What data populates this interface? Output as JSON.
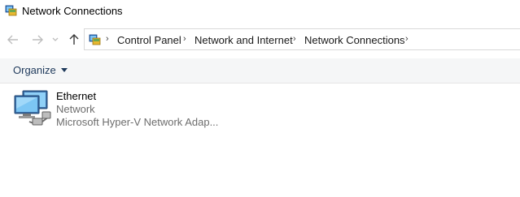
{
  "window": {
    "title": "Network Connections",
    "icon": "network-connections-icon"
  },
  "nav": {
    "back_icon": "arrow-left-icon",
    "forward_icon": "arrow-right-icon",
    "recent_icon": "chevron-down-icon",
    "up_icon": "arrow-up-icon"
  },
  "address": {
    "icon": "control-panel-icon",
    "crumbs": [
      "Control Panel",
      "Network and Internet",
      "Network Connections"
    ]
  },
  "toolbar": {
    "organize_label": "Organize"
  },
  "connections": [
    {
      "name": "Ethernet",
      "status": "Network",
      "device": "Microsoft Hyper-V Network Adap...",
      "icon": "ethernet-adapter-icon"
    }
  ],
  "colors": {
    "accent_text": "#1e395b",
    "cmdbar_bg": "#f5f6f7",
    "secondary_text": "#6d6d6d"
  }
}
